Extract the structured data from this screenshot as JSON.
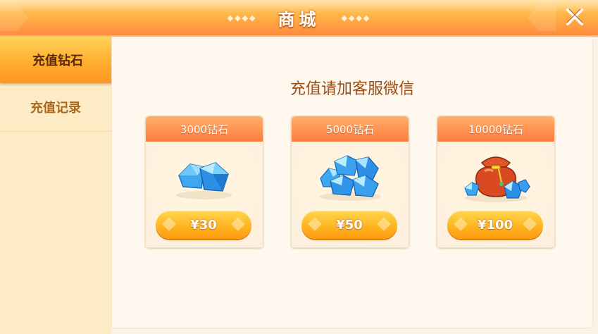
{
  "header": {
    "title": "商城",
    "left_deco": "◆◆◆◆",
    "right_deco": "◆◆◆◆",
    "close_icon": "close-icon"
  },
  "sidebar": {
    "tabs": [
      {
        "label": "充值钻石",
        "active": true
      },
      {
        "label": "充值记录",
        "active": false
      }
    ]
  },
  "main": {
    "heading": "充值请加客服微信",
    "cards": [
      {
        "title": "3000钻石",
        "price": "¥30",
        "icon": "diamond-pile-icon"
      },
      {
        "title": "5000钻石",
        "price": "¥50",
        "icon": "diamond-heap-icon"
      },
      {
        "title": "10000钻石",
        "price": "¥100",
        "icon": "money-bag-icon"
      }
    ]
  },
  "colors": {
    "header_orange": "#ffb347",
    "card_head": "#ff7b3e",
    "price_button": "#ffb21e",
    "heading_text": "#9b4b14",
    "active_tab_text": "#5a2b06",
    "inactive_tab_text": "#a9681f"
  }
}
